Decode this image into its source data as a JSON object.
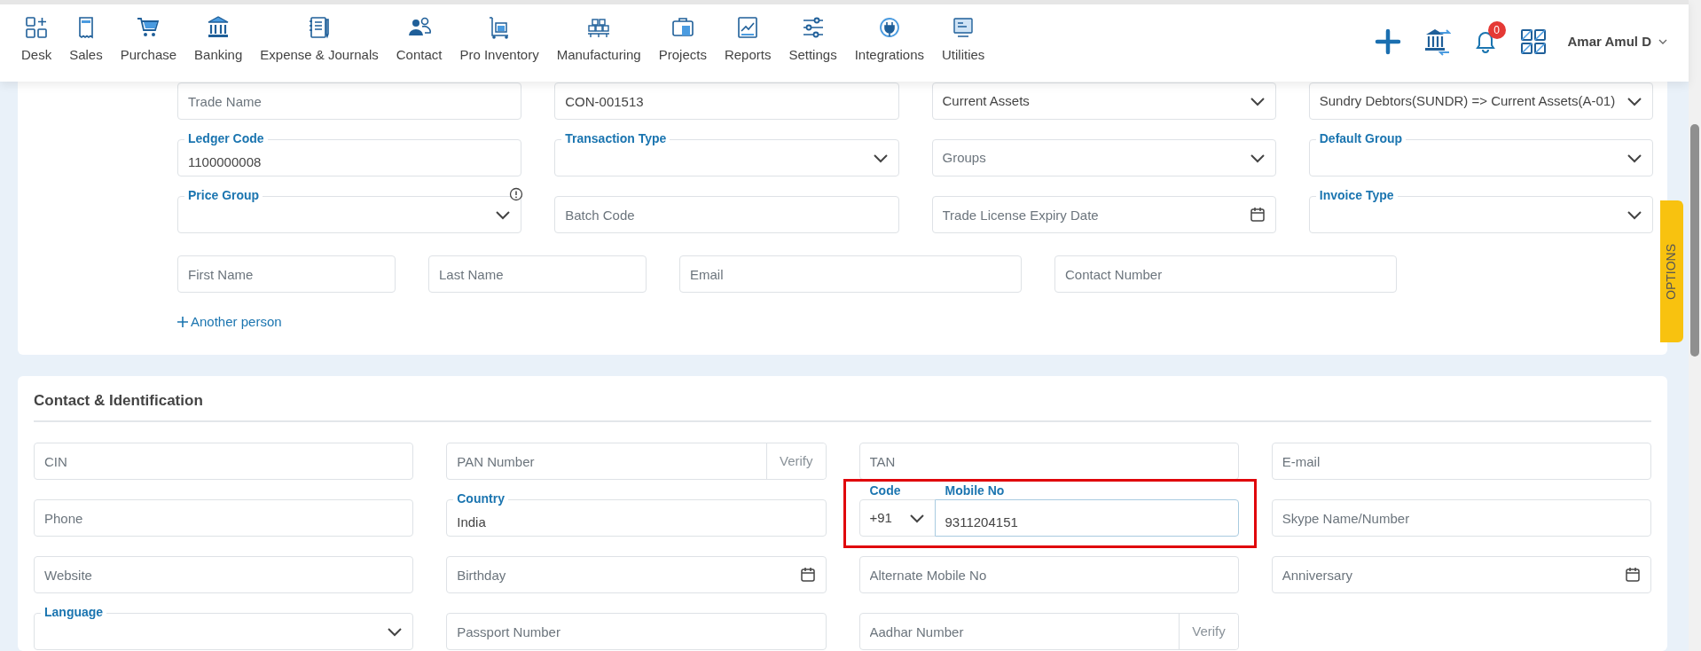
{
  "navbar": {
    "items": [
      {
        "label": "Desk"
      },
      {
        "label": "Sales"
      },
      {
        "label": "Purchase"
      },
      {
        "label": "Banking"
      },
      {
        "label": "Expense & Journals"
      },
      {
        "label": "Contact"
      },
      {
        "label": "Pro Inventory"
      },
      {
        "label": "Manufacturing"
      },
      {
        "label": "Projects"
      },
      {
        "label": "Reports"
      },
      {
        "label": "Settings"
      },
      {
        "label": "Integrations"
      },
      {
        "label": "Utilities"
      }
    ],
    "notification_count": "0",
    "user_name": "Amar Amul D"
  },
  "business_section": {
    "rows": [
      [
        {
          "kind": "input",
          "placeholder": "Trade Name"
        },
        {
          "kind": "input",
          "value": "CON-001513"
        },
        {
          "kind": "select",
          "value": "Current Assets"
        },
        {
          "kind": "select",
          "value": "Sundry Debtors(SUNDR) => Current Assets(A-01)"
        }
      ],
      [
        {
          "kind": "input",
          "label": "Ledger Code",
          "value": "1100000008"
        },
        {
          "kind": "select",
          "label": "Transaction Type"
        },
        {
          "kind": "select",
          "placeholder": "Groups"
        },
        {
          "kind": "select",
          "label": "Default Group"
        }
      ],
      [
        {
          "kind": "select",
          "label": "Price Group",
          "info": true
        },
        {
          "kind": "input",
          "placeholder": "Batch Code"
        },
        {
          "kind": "date",
          "placeholder": "Trade License Expiry Date"
        },
        {
          "kind": "select",
          "label": "Invoice Type"
        }
      ]
    ],
    "person_fields": [
      {
        "kind": "input",
        "placeholder": "First Name"
      },
      {
        "kind": "input",
        "placeholder": "Last Name"
      },
      {
        "kind": "input",
        "placeholder": "Email"
      },
      {
        "kind": "input",
        "placeholder": "Contact Number"
      }
    ],
    "add_person_link": "Another person"
  },
  "options_tab": "OPTIONS",
  "contact_section": {
    "title": "Contact & Identification",
    "rows": [
      [
        {
          "kind": "input",
          "placeholder": "CIN"
        },
        {
          "kind": "verify",
          "placeholder": "PAN Number",
          "addon": "Verify"
        },
        {
          "kind": "input",
          "placeholder": "TAN"
        },
        {
          "kind": "input",
          "placeholder": "E-mail"
        }
      ],
      [
        {
          "kind": "input",
          "placeholder": "Phone"
        },
        {
          "kind": "input",
          "label": "Country",
          "value": "India"
        },
        {
          "kind": "phone",
          "code_label": "Code",
          "code": "+91",
          "label": "Mobile No",
          "value": "9311204151",
          "highlighted": true
        },
        {
          "kind": "input",
          "placeholder": "Skype Name/Number"
        }
      ],
      [
        {
          "kind": "input",
          "placeholder": "Website"
        },
        {
          "kind": "date",
          "placeholder": "Birthday"
        },
        {
          "kind": "input",
          "placeholder": "Alternate Mobile No"
        },
        {
          "kind": "date",
          "placeholder": "Anniversary"
        }
      ],
      [
        {
          "kind": "select",
          "label": "Language"
        },
        {
          "kind": "input",
          "placeholder": "Passport Number"
        },
        {
          "kind": "verify",
          "placeholder": "Aadhar Number",
          "addon": "Verify"
        }
      ]
    ]
  }
}
